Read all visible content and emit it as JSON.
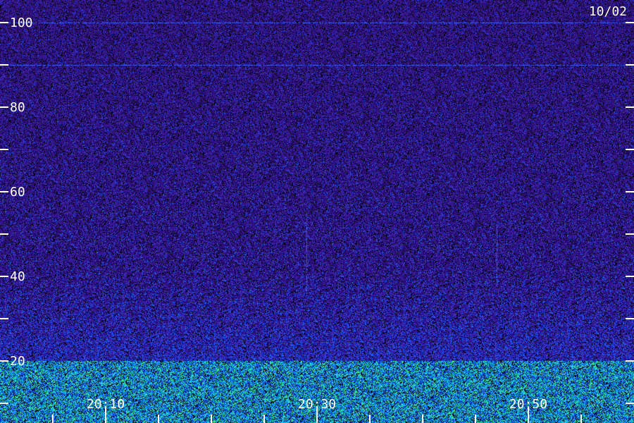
{
  "chart_data": {
    "type": "heatmap",
    "title": "",
    "date_label": "10/02",
    "xlabel": "",
    "ylabel": "",
    "y_ticks": [
      {
        "value": 100,
        "label": "100"
      },
      {
        "value": 90,
        "label": ""
      },
      {
        "value": 80,
        "label": "80"
      },
      {
        "value": 70,
        "label": ""
      },
      {
        "value": 60,
        "label": "60"
      },
      {
        "value": 50,
        "label": ""
      },
      {
        "value": 40,
        "label": "40"
      },
      {
        "value": 30,
        "label": ""
      },
      {
        "value": 20,
        "label": "20"
      },
      {
        "value": 10,
        "label": ""
      }
    ],
    "x_ticks": [
      {
        "value": "20:05",
        "label": ""
      },
      {
        "value": "20:10",
        "label": "20:10"
      },
      {
        "value": "20:15",
        "label": ""
      },
      {
        "value": "20:20",
        "label": ""
      },
      {
        "value": "20:25",
        "label": ""
      },
      {
        "value": "20:30",
        "label": "20:30"
      },
      {
        "value": "20:35",
        "label": ""
      },
      {
        "value": "20:40",
        "label": ""
      },
      {
        "value": "20:45",
        "label": ""
      },
      {
        "value": "20:50",
        "label": "20:50"
      },
      {
        "value": "20:55",
        "label": ""
      }
    ],
    "xlim": [
      "20:05",
      "20:55"
    ],
    "ylim": [
      10,
      100
    ],
    "grid": false,
    "colormap": [
      "#000000",
      "#2a0f6e",
      "#3a1aa8",
      "#2848ff",
      "#00b0ff",
      "#40ff80"
    ],
    "features": [
      {
        "type": "horizontal_line",
        "y": 100,
        "color": "#3a6cff"
      },
      {
        "type": "horizontal_line",
        "y": 90,
        "color": "#3a4cff"
      },
      {
        "type": "vertical_streak",
        "time": "20:29",
        "y_range": [
          36,
          55
        ]
      },
      {
        "type": "vertical_streak",
        "time": "20:47",
        "y_range": [
          38,
          52
        ]
      },
      {
        "type": "noise_band",
        "y_range": [
          10,
          20
        ],
        "color": "#40ff80"
      }
    ]
  }
}
